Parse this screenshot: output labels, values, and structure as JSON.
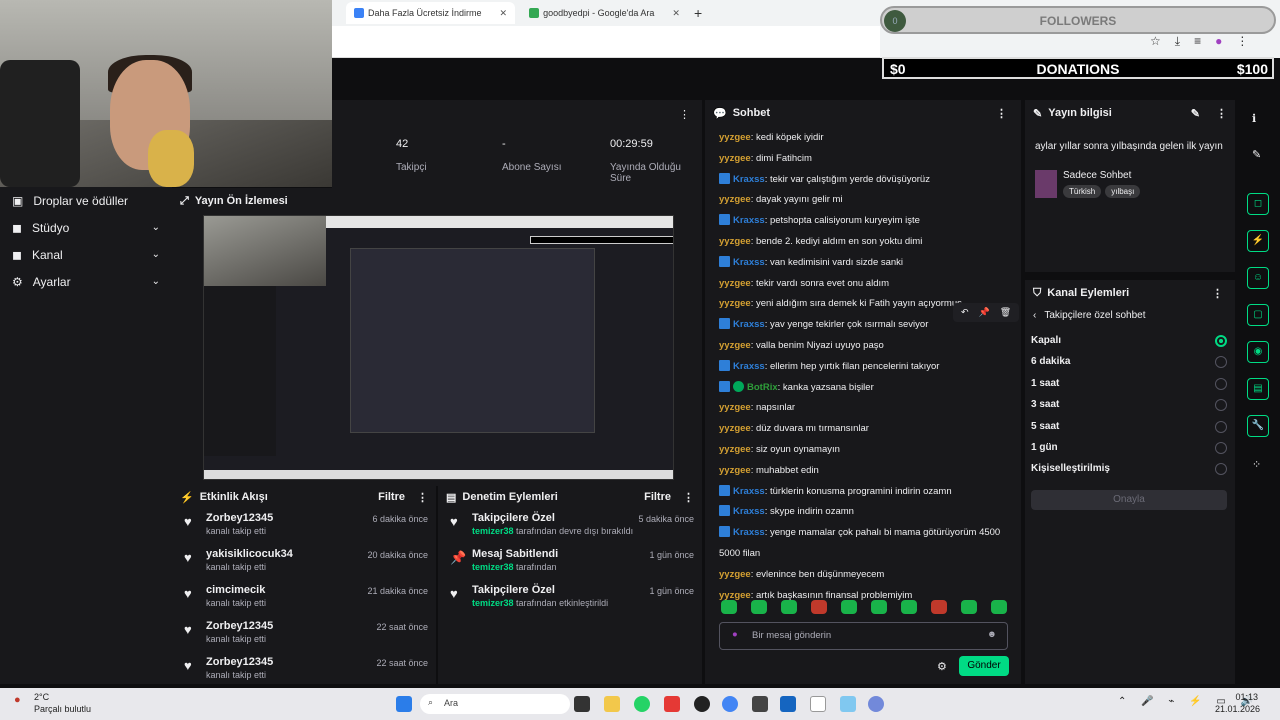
{
  "browser": {
    "tabs": [
      {
        "label": "Daha Fazla Ücretsiz İndirme",
        "active": true
      },
      {
        "label": "goodbyedpi - Google'da Ara",
        "active": false
      }
    ]
  },
  "overlay": {
    "followers_label": "FOLLOWERS",
    "donations_label": "DONATIONS",
    "donations_min": "$0",
    "donations_max": "$100"
  },
  "sidebar": {
    "items": [
      {
        "label": "Droplar ve ödüller",
        "icon": "gift-icon"
      },
      {
        "label": "Stüdyo",
        "icon": "studio-icon"
      },
      {
        "label": "Kanal",
        "icon": "channel-icon"
      },
      {
        "label": "Ayarlar",
        "icon": "settings-icon"
      }
    ]
  },
  "stats": [
    {
      "value": "42",
      "label": "Takipçi"
    },
    {
      "value": "-",
      "label": "Abone Sayısı"
    },
    {
      "value": "00:29:59",
      "label": "Yayında Olduğu Süre"
    }
  ],
  "preview": {
    "title": "Yayın Ön İzlemesi"
  },
  "activity": {
    "title": "Etkinlik Akışı",
    "filter": "Filtre",
    "events": [
      {
        "name": "Zorbey12345",
        "sub": "kanalı takip etti",
        "time": "6 dakika önce"
      },
      {
        "name": "yakisiklicocuk34",
        "sub": "kanalı takip etti",
        "time": "20 dakika önce"
      },
      {
        "name": "cimcimecik",
        "sub": "kanalı takip etti",
        "time": "21 dakika önce"
      },
      {
        "name": "Zorbey12345",
        "sub": "kanalı takip etti",
        "time": "22 saat önce"
      },
      {
        "name": "Zorbey12345",
        "sub": "kanalı takip etti",
        "time": "22 saat önce"
      }
    ]
  },
  "moderation": {
    "title": "Denetim Eylemleri",
    "filter": "Filtre",
    "events": [
      {
        "name": "Takipçilere Özel",
        "user": "temizer38",
        "sub": " tarafından devre dışı bırakıldı",
        "time": "5 dakika önce",
        "icon": "heart-icon"
      },
      {
        "name": "Mesaj Sabitlendi",
        "user": "temizer38",
        "sub": " tarafından",
        "time": "1 gün önce",
        "icon": "pin-icon"
      },
      {
        "name": "Takipçilere Özel",
        "user": "temizer38",
        "sub": " tarafından etkinleştirildi",
        "time": "1 gün önce",
        "icon": "heart-icon"
      }
    ]
  },
  "chat": {
    "title": "Sohbet",
    "messages": [
      {
        "user": "yyzgee",
        "type": "y",
        "text": "kedi köpek iyidir"
      },
      {
        "user": "yyzgee",
        "type": "y",
        "text": "dimi Fatihcim"
      },
      {
        "user": "Kraxss",
        "type": "k",
        "text": "tekir var çalıştığım yerde dövüşüyorüz"
      },
      {
        "user": "yyzgee",
        "type": "y",
        "text": "dayak yayını gelir mi"
      },
      {
        "user": "Kraxss",
        "type": "k",
        "text": "petshopta calisiyorum kuryeyim işte"
      },
      {
        "user": "yyzgee",
        "type": "y",
        "text": "bende 2. kediyi aldım en son yoktu dimi"
      },
      {
        "user": "Kraxss",
        "type": "k",
        "text": "van kedimisini vardı sizde sanki"
      },
      {
        "user": "yyzgee",
        "type": "y",
        "text": "tekir vardı sonra evet onu aldım"
      },
      {
        "user": "yyzgee",
        "type": "y",
        "text": "yeni aldığım sıra demek ki Fatih yayın açıyormuş"
      },
      {
        "user": "Kraxss",
        "type": "k",
        "text": "yav yenge tekirler çok ısırmalı seviyor"
      },
      {
        "user": "yyzgee",
        "type": "y",
        "text": "valla benim Niyazi uyuyo paşo"
      },
      {
        "user": "Kraxss",
        "type": "k",
        "text": "ellerim hep yırtık filan pencelerini takıyor"
      },
      {
        "user": "BotRix",
        "type": "b",
        "text": "kanka yazsana bişiler"
      },
      {
        "user": "yyzgee",
        "type": "y",
        "text": "napsınlar"
      },
      {
        "user": "yyzgee",
        "type": "y",
        "text": "düz duvara mı tırmansınlar"
      },
      {
        "user": "yyzgee",
        "type": "y",
        "text": "siz oyun oynamayın"
      },
      {
        "user": "yyzgee",
        "type": "y",
        "text": "muhabbet edin"
      },
      {
        "user": "Kraxss",
        "type": "k",
        "text": "türklerin konusma programini indirin ozamn"
      },
      {
        "user": "Kraxss",
        "type": "k",
        "text": "skype indirin ozamn"
      },
      {
        "user": "Kraxss",
        "type": "k",
        "text": "yenge mamalar çok pahalı bi mama götürüyorüm 4500"
      },
      {
        "user": "",
        "type": "c",
        "text": "5000 filan"
      },
      {
        "user": "yyzgee",
        "type": "y",
        "text": "evlenince ben düşünmeyecem"
      },
      {
        "user": "yyzgee",
        "type": "y",
        "text": "artık başkasının finansal problemiyim"
      }
    ],
    "input_placeholder": "Bir mesaj gönderin",
    "send_label": "Gönder"
  },
  "stream_info": {
    "title": "Yayın bilgisi",
    "stream_title": "aylar yıllar sonra yılbaşında gelen ilk yayın",
    "category": "Sadece Sohbet",
    "tags": [
      "Türkish",
      "yılbaşı"
    ]
  },
  "channel_actions": {
    "title": "Kanal Eylemleri",
    "back_label": "Takipçilere özel sohbet",
    "options": [
      "Kapalı",
      "6 dakika",
      "1 saat",
      "3 saat",
      "5 saat",
      "1 gün",
      "Kişiselleştirilmiş"
    ],
    "selected": "Kapalı",
    "confirm": "Onayla"
  },
  "taskbar": {
    "weather_temp": "2°C",
    "weather_desc": "Parçalı bulutlu",
    "search_placeholder": "Ara",
    "time": "01:13",
    "date": "21.01.2026"
  }
}
